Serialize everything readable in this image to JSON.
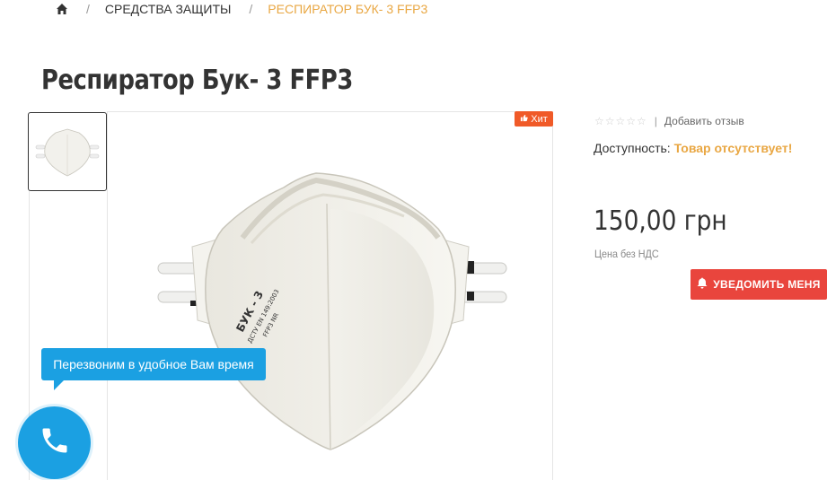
{
  "breadcrumb": {
    "home_icon": "home-icon",
    "separator": "/",
    "category": "СРЕДСТВА ЗАЩИТЫ",
    "current": "РЕСПИРАТОР БУК- 3 FFP3"
  },
  "product": {
    "title": "Респиратор Бук- 3 FFP3",
    "badge_label": "Хит",
    "badge_icon": "thumbs-up-icon",
    "rating_stars": "☆☆☆☆☆",
    "rating": 0,
    "review_separator": "|",
    "review_link": "Добавить отзыв",
    "availability_label": "Доступность:",
    "availability_status": "Товар отсутствует!",
    "price": "150,00 грн",
    "price_note": "Цена без НДС",
    "notify_button": "УВЕДОМИТЬ МЕНЯ",
    "notify_icon": "bell-icon",
    "mask_text": [
      "БУК - 3",
      "ДСТУ EN 149:2003",
      "FFP3 NR"
    ]
  },
  "callback": {
    "tooltip": "Перезвоним в удобное Вам время",
    "phone_icon": "phone-icon"
  },
  "colors": {
    "accent_orange": "#e9a743",
    "badge_orange": "#f05a28",
    "notify_red": "#e9453d",
    "callback_blue": "#1ba0e2"
  }
}
